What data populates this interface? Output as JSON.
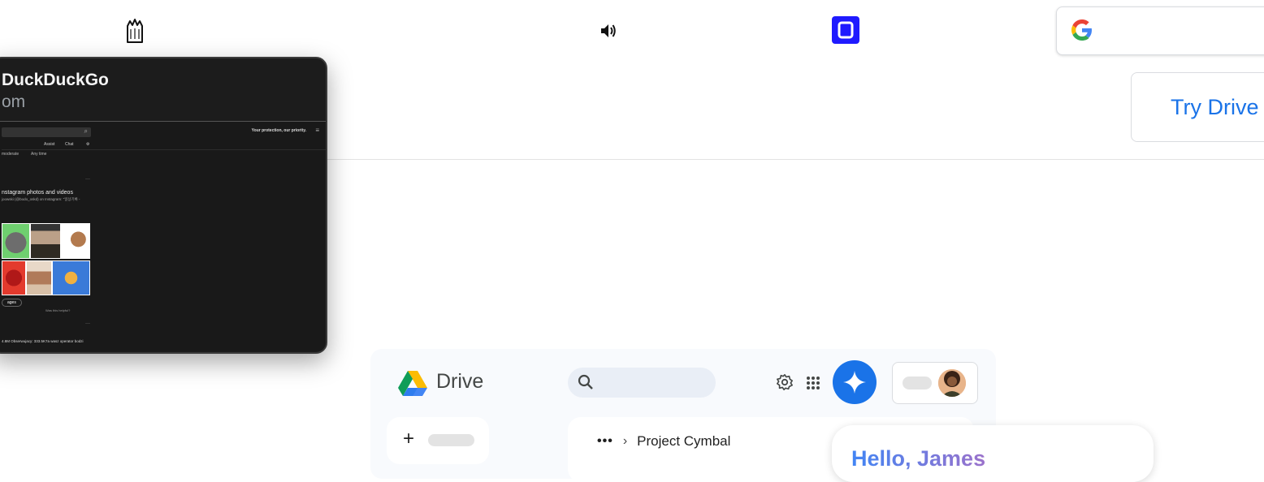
{
  "topbar": {
    "icons": [
      "app-icon",
      "speaker-icon",
      "square-app-icon"
    ],
    "search_logo": "G",
    "try_drive_label": "Try Drive"
  },
  "ddg_preview": {
    "title": "DuckDuckGo",
    "url_fragment": "om",
    "protection_text": "Your protection, our priority.",
    "assist_label": "Assist",
    "chat_label": "Chat",
    "filter_safe": "moderate",
    "filter_time": "Any time",
    "result_title": "nstagram photos and videos",
    "result_sub": "joowski (@bodo_oskd) on Instagram: \"일상기록 -",
    "images_link": "ages",
    "helpful_text": "Was this helpful?",
    "snippet": "4.8M Obserwujacy: 333.5K7a wasz operator bodzi"
  },
  "drive": {
    "app_name": "Drive",
    "breadcrumb_current": "Project Cymbal",
    "greeting": "Hello, James"
  },
  "colors": {
    "accent": "#1a73e8",
    "square_app": "#1f1aff",
    "ddg_bg": "#1c1c1c",
    "drive_bg": "#f8fafd"
  }
}
